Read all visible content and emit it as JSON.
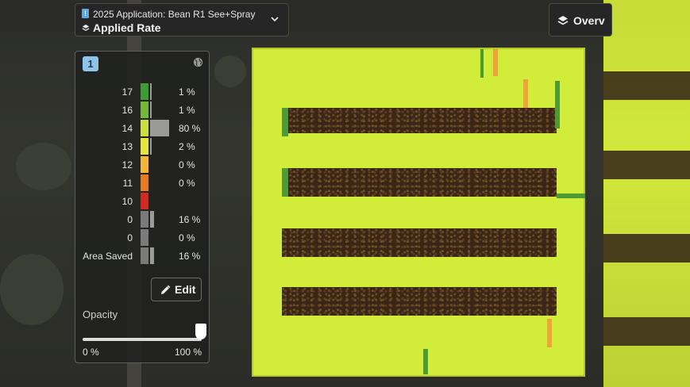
{
  "selector": {
    "app_title": "2025 Application: Bean R1 See+Spray",
    "layer_label": "Applied Rate",
    "icons": {
      "document": "document-icon",
      "layers": "layers-icon",
      "dropdown": "chevron-down-icon"
    }
  },
  "overview": {
    "label": "Overv",
    "icon": "layers-icon"
  },
  "legend": {
    "badge": "1",
    "globe_icon": "globe-icon",
    "rows": [
      {
        "label": "17",
        "color": "#3e9c35",
        "percent": "1 %",
        "fraction": 0.01
      },
      {
        "label": "16",
        "color": "#74b83a",
        "percent": "1 %",
        "fraction": 0.01
      },
      {
        "label": "14",
        "color": "#c9e03d",
        "percent": "80 %",
        "fraction": 0.8
      },
      {
        "label": "13",
        "color": "#e8e53a",
        "percent": "2 %",
        "fraction": 0.02
      },
      {
        "label": "12",
        "color": "#f1b63a",
        "percent": "0 %",
        "fraction": 0.0
      },
      {
        "label": "11",
        "color": "#e67c22",
        "percent": "0 %",
        "fraction": 0.0
      },
      {
        "label": "10",
        "color": "#cf2b20",
        "percent": "",
        "fraction": 0.0
      },
      {
        "label": "0",
        "color": "#7a7a7a",
        "percent": "16 %",
        "fraction": 0.16
      },
      {
        "label": "0",
        "color": "#7a7a7a",
        "percent": "0 %",
        "fraction": 0.0
      },
      {
        "label": "Area Saved",
        "color": "#7a7a7a",
        "percent": "16 %",
        "fraction": 0.16
      }
    ],
    "edit": {
      "label": "Edit",
      "icon": "pencil-icon"
    },
    "opacity": {
      "label": "Opacity",
      "min_label": "0 %",
      "max_label": "100 %",
      "value": 1.0
    }
  },
  "colors": {
    "applied": "#d2ec3a",
    "skipped": "#3a2517"
  }
}
